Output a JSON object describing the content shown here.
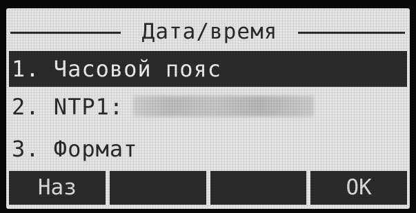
{
  "screen": {
    "title": "Дата/время"
  },
  "menu": {
    "items": [
      {
        "label": "1. Часовой пояс"
      },
      {
        "label": "2. NTP1:"
      },
      {
        "label": "3. Формат"
      }
    ]
  },
  "softkeys": {
    "back_label": "Наз",
    "key2_label": "",
    "key3_label": "",
    "ok_label": "OK"
  }
}
